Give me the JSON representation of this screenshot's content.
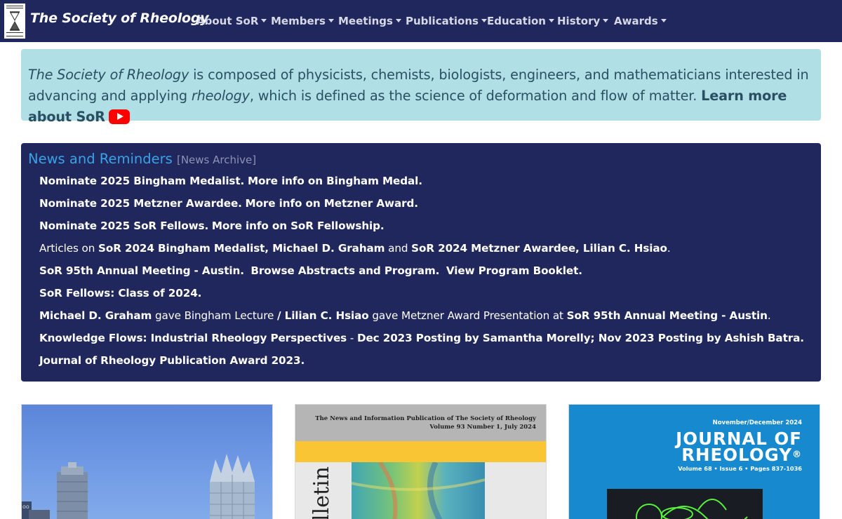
{
  "navbar": {
    "brand": "The Society of Rheology",
    "items": [
      {
        "label": "About SoR"
      },
      {
        "label": "Members"
      },
      {
        "label": "Meetings"
      },
      {
        "label": "Publications"
      },
      {
        "label": "Education"
      },
      {
        "label": "History"
      },
      {
        "label": "Awards"
      }
    ]
  },
  "intro": {
    "society_name": "The Society of Rheology",
    "text1": " is composed of physicists, chemists, biologists, engineers, and mathematicians interested in advancing and applying ",
    "rheology": "rheology",
    "text2": ", which is defined as the science of deformation and flow of matter. ",
    "learn_more": "Learn more about SoR"
  },
  "news": {
    "title": "News and Reminders",
    "archive": "[News Archive]",
    "row1": {
      "a": "Nominate 2025 Bingham Medalist.",
      "b": "More info on Bingham Medal."
    },
    "row2": {
      "a": "Nominate 2025 Metzner Awardee.",
      "b": "More info on Metzner Award."
    },
    "row3": {
      "a": "Nominate 2025 SoR Fellows.",
      "b": "More info on SoR Fellowship."
    },
    "row4": {
      "pre": "Articles on ",
      "a": "SoR 2024 Bingham Medalist, Michael D. Graham",
      "mid": " and ",
      "b": "SoR 2024 Metzner Awardee, Lilian C. Hsiao",
      "post": "."
    },
    "row5": {
      "a": "SoR 95th Annual Meeting - Austin.",
      "b": "Browse Abstracts and Program.",
      "c": "View Program Booklet."
    },
    "row6": {
      "a": "SoR Fellows: Class of 2024."
    },
    "row7": {
      "a": "Michael D. Graham",
      "t1": " gave Bingham Lecture ",
      "sep": "/",
      "b": " Lilian C. Hsiao",
      "t2": " gave Metzner Award Presentation at ",
      "c": "SoR 95th Annual Meeting - Austin",
      "post": "."
    },
    "row8": {
      "a": "Knowledge Flows: Industrial Rheology Perspectives",
      "t1": " - ",
      "b": "Dec 2023 Posting by Samantha Morelly",
      "t2": "; ",
      "c": "Nov 2023 Posting by Ashish Batra",
      "post": "."
    },
    "row9": {
      "a": "Journal of Rheology Publication Award 2023."
    }
  },
  "cards": {
    "bulletin": {
      "header1": "The News and Information Publication of The Society of Rheology",
      "header2": "Volume 93 Number 1, July 2024",
      "vertical": "lletin"
    },
    "journal": {
      "issue": "November/December 2024",
      "line1": "JOURNAL OF",
      "line2": "RHEOLOGY",
      "reg": "®",
      "vol": "Volume 68 • Issue 6 • Pages 837-1036"
    }
  },
  "colors": {
    "navbar": "#20275c",
    "intro_bg": "#b0dfe6",
    "news_bg": "#20275c",
    "news_title": "#3aa3e8",
    "youtube": "#ff0000"
  }
}
